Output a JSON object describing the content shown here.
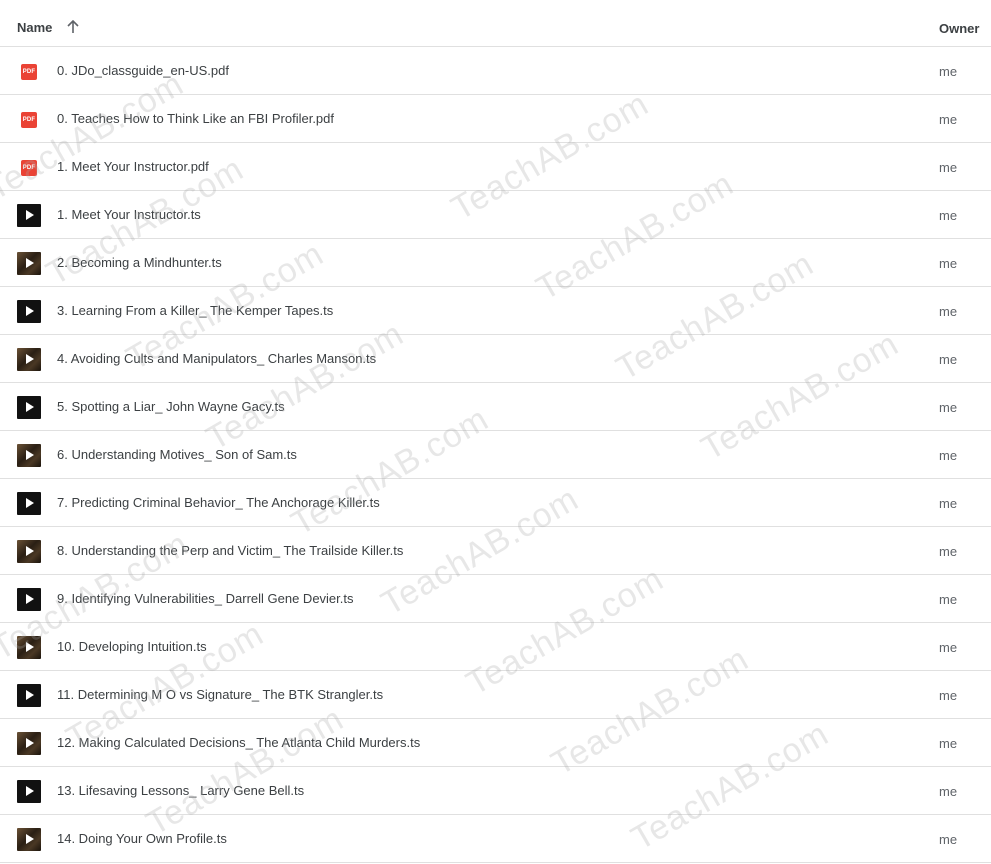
{
  "header": {
    "name_label": "Name",
    "owner_label": "Owner",
    "sort_icon": "arrow-up-icon"
  },
  "files": [
    {
      "name": "0. JDo_classguide_en-US.pdf",
      "type": "pdf",
      "icon": "pdf-icon",
      "owner": "me"
    },
    {
      "name": "0. Teaches How to Think Like an FBI Profiler.pdf",
      "type": "pdf",
      "icon": "pdf-icon",
      "owner": "me"
    },
    {
      "name": "1. Meet Your Instructor.pdf",
      "type": "pdf",
      "icon": "pdf-icon",
      "owner": "me"
    },
    {
      "name": "1. Meet Your Instructor.ts",
      "type": "video",
      "icon": "video-play-icon",
      "owner": "me"
    },
    {
      "name": "2. Becoming a Mindhunter.ts",
      "type": "video-thumb",
      "icon": "video-thumbnail-icon",
      "owner": "me"
    },
    {
      "name": "3. Learning From a Killer_ The Kemper Tapes.ts",
      "type": "video",
      "icon": "video-play-icon",
      "owner": "me"
    },
    {
      "name": "4. Avoiding Cults and Manipulators_ Charles Manson.ts",
      "type": "video-thumb",
      "icon": "video-thumbnail-icon",
      "owner": "me"
    },
    {
      "name": "5. Spotting a Liar_ John Wayne Gacy.ts",
      "type": "video",
      "icon": "video-play-icon",
      "owner": "me"
    },
    {
      "name": "6. Understanding Motives_ Son of Sam.ts",
      "type": "video-thumb",
      "icon": "video-thumbnail-icon",
      "owner": "me"
    },
    {
      "name": "7. Predicting Criminal Behavior_ The Anchorage Killer.ts",
      "type": "video",
      "icon": "video-play-icon",
      "owner": "me"
    },
    {
      "name": "8. Understanding the Perp and Victim_ The Trailside Killer.ts",
      "type": "video-thumb",
      "icon": "video-thumbnail-icon",
      "owner": "me"
    },
    {
      "name": "9. Identifying Vulnerabilities_ Darrell Gene Devier.ts",
      "type": "video",
      "icon": "video-play-icon",
      "owner": "me"
    },
    {
      "name": "10. Developing Intuition.ts",
      "type": "video-thumb",
      "icon": "video-thumbnail-icon",
      "owner": "me"
    },
    {
      "name": "11. Determining M O vs Signature_ The BTK Strangler.ts",
      "type": "video",
      "icon": "video-play-icon",
      "owner": "me"
    },
    {
      "name": "12. Making Calculated Decisions_ The Atlanta Child Murders.ts",
      "type": "video-thumb",
      "icon": "video-thumbnail-icon",
      "owner": "me"
    },
    {
      "name": "13. Lifesaving Lessons_ Larry Gene Bell.ts",
      "type": "video",
      "icon": "video-play-icon",
      "owner": "me"
    },
    {
      "name": "14. Doing Your Own Profile.ts",
      "type": "video-thumb",
      "icon": "video-thumbnail-icon",
      "owner": "me"
    }
  ],
  "watermark": "TeachAB.com",
  "colors": {
    "pdf_red": "#ea4335",
    "divider": "#e0e0e0",
    "text": "#3c4043"
  }
}
